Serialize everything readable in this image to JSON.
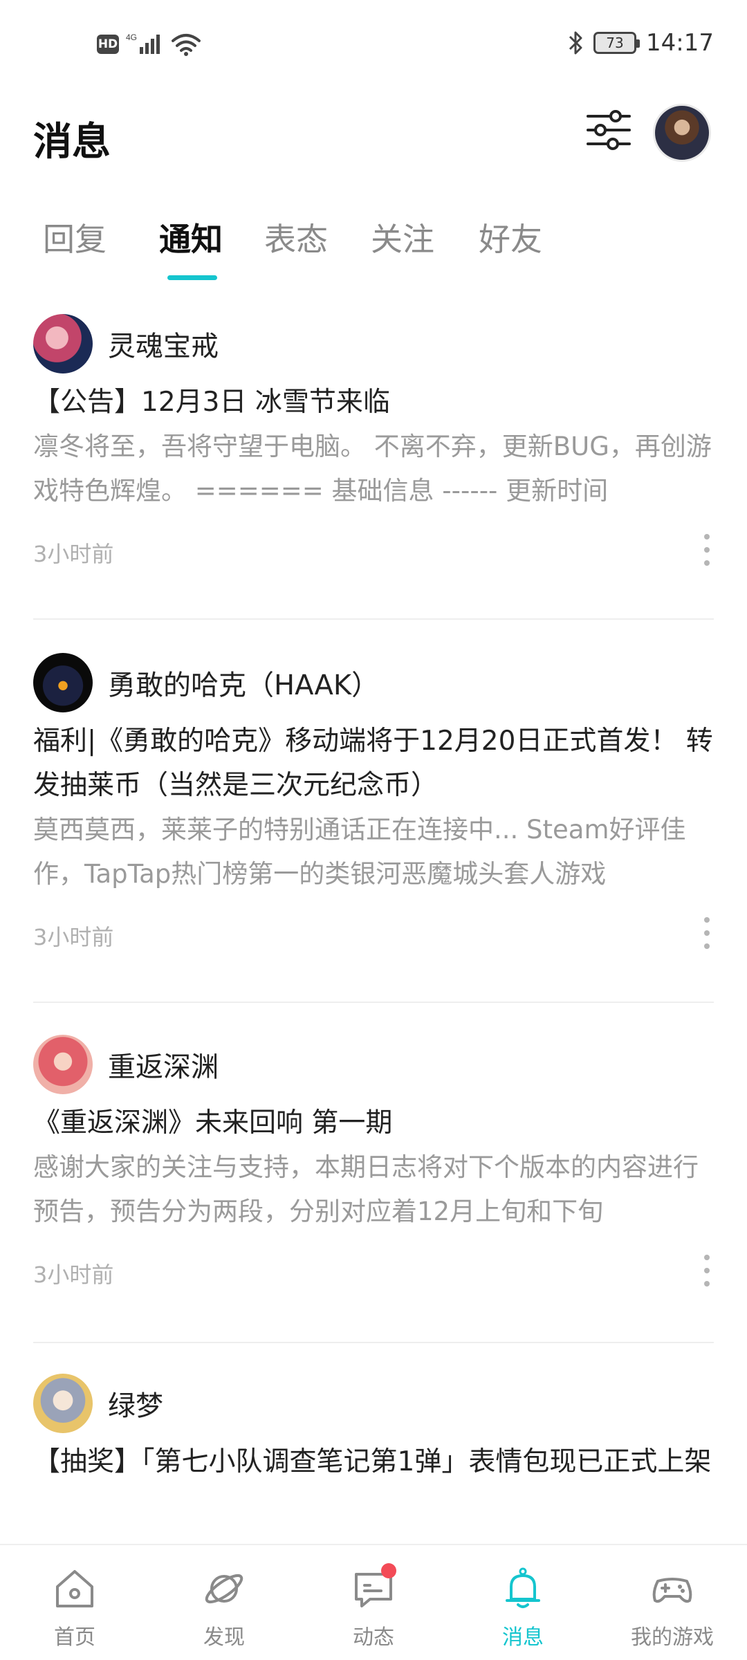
{
  "status_bar": {
    "hd": "HD",
    "network": "4G",
    "battery": "73",
    "time": "14:17"
  },
  "header": {
    "title": "消息"
  },
  "tabs": [
    {
      "label": "回复"
    },
    {
      "label": "通知"
    },
    {
      "label": "表态"
    },
    {
      "label": "关注"
    },
    {
      "label": "好友"
    }
  ],
  "active_tab": "通知",
  "notifications": [
    {
      "author": "灵魂宝戒",
      "title": "【公告】12月3日 冰雪节来临",
      "excerpt": "凛冬将至，吾将守望于电脑。 不离不弃，更新BUG，再创游戏特色辉煌。 ====== 基础信息 ------ 更新时间",
      "time": "3小时前"
    },
    {
      "author": "勇敢的哈克（HAAK）",
      "title": "福利|《勇敢的哈克》移动端将于12月20日正式首发！ 转发抽莱币（当然是三次元纪念币）",
      "excerpt": "莫西莫西，莱莱子的特别通话正在连接中... Steam好评佳作，TapTap热门榜第一的类银河恶魔城头套人游戏",
      "time": "3小时前"
    },
    {
      "author": "重返深渊",
      "title": "《重返深渊》未来回响 第一期",
      "excerpt": "感谢大家的关注与支持，本期日志将对下个版本的内容进行预告，预告分为两段，分别对应着12月上旬和下旬",
      "time": "3小时前"
    },
    {
      "author": "绿梦",
      "title": "【抽奖】「第七小队调查笔记第1弹」表情包现已正式上架",
      "excerpt": "",
      "time": ""
    }
  ],
  "bottom_nav": [
    {
      "label": "首页",
      "icon": "home-icon"
    },
    {
      "label": "发现",
      "icon": "planet-icon"
    },
    {
      "label": "动态",
      "icon": "chat-icon"
    },
    {
      "label": "消息",
      "icon": "bell-icon"
    },
    {
      "label": "我的游戏",
      "icon": "gamepad-icon"
    }
  ],
  "active_nav": "消息",
  "colors": {
    "accent": "#15c5ce",
    "badge_red": "#f34b57",
    "muted_text": "#9a9a9a"
  }
}
